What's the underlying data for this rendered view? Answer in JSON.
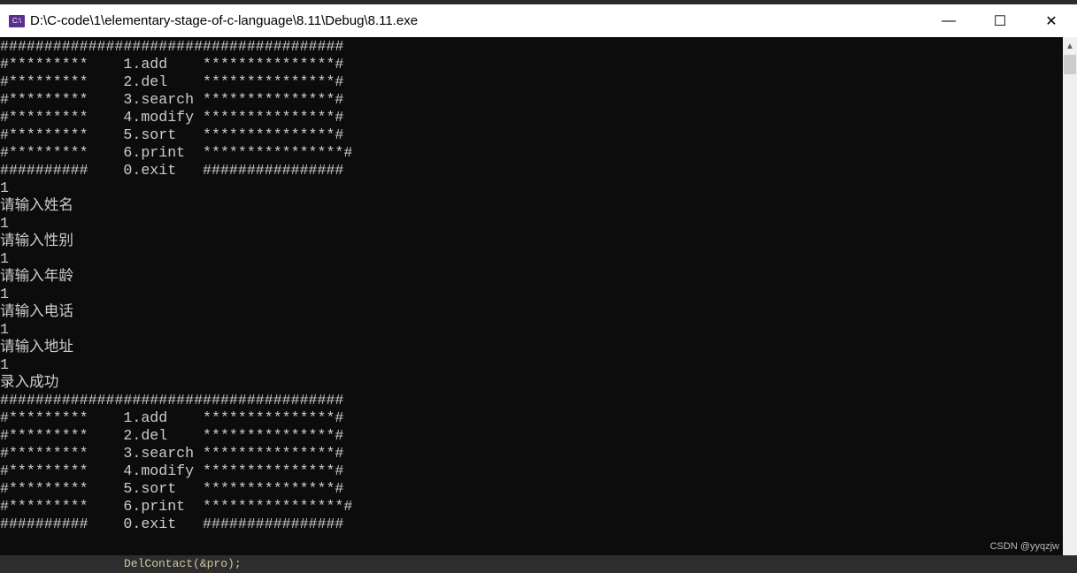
{
  "window": {
    "title": "D:\\C-code\\1\\elementary-stage-of-c-language\\8.11\\Debug\\8.11.exe",
    "app_icon": "console-app-icon",
    "buttons": {
      "minimize": "—",
      "maximize": "☐",
      "close": "✕"
    }
  },
  "console": {
    "lines": [
      "#######################################",
      "#*********    1.add    ***************#",
      "#*********    2.del    ***************#",
      "#*********    3.search ***************#",
      "#*********    4.modify ***************#",
      "#*********    5.sort   ***************#",
      "#*********    6.print  ****************#",
      "##########    0.exit   ################",
      "1",
      "请输入姓名",
      "1",
      "请输入性别",
      "1",
      "请输入年龄",
      "1",
      "请输入电话",
      "1",
      "请输入地址",
      "1",
      "录入成功",
      "#######################################",
      "#*********    1.add    ***************#",
      "#*********    2.del    ***************#",
      "#*********    3.search ***************#",
      "#*********    4.modify ***************#",
      "#*********    5.sort   ***************#",
      "#*********    6.print  ****************#",
      "##########    0.exit   ################"
    ],
    "text_color": "#cccccc",
    "background": "#0c0c0c"
  },
  "background_code": "DelContact(&pro);",
  "watermark": "CSDN @yyqzjw"
}
